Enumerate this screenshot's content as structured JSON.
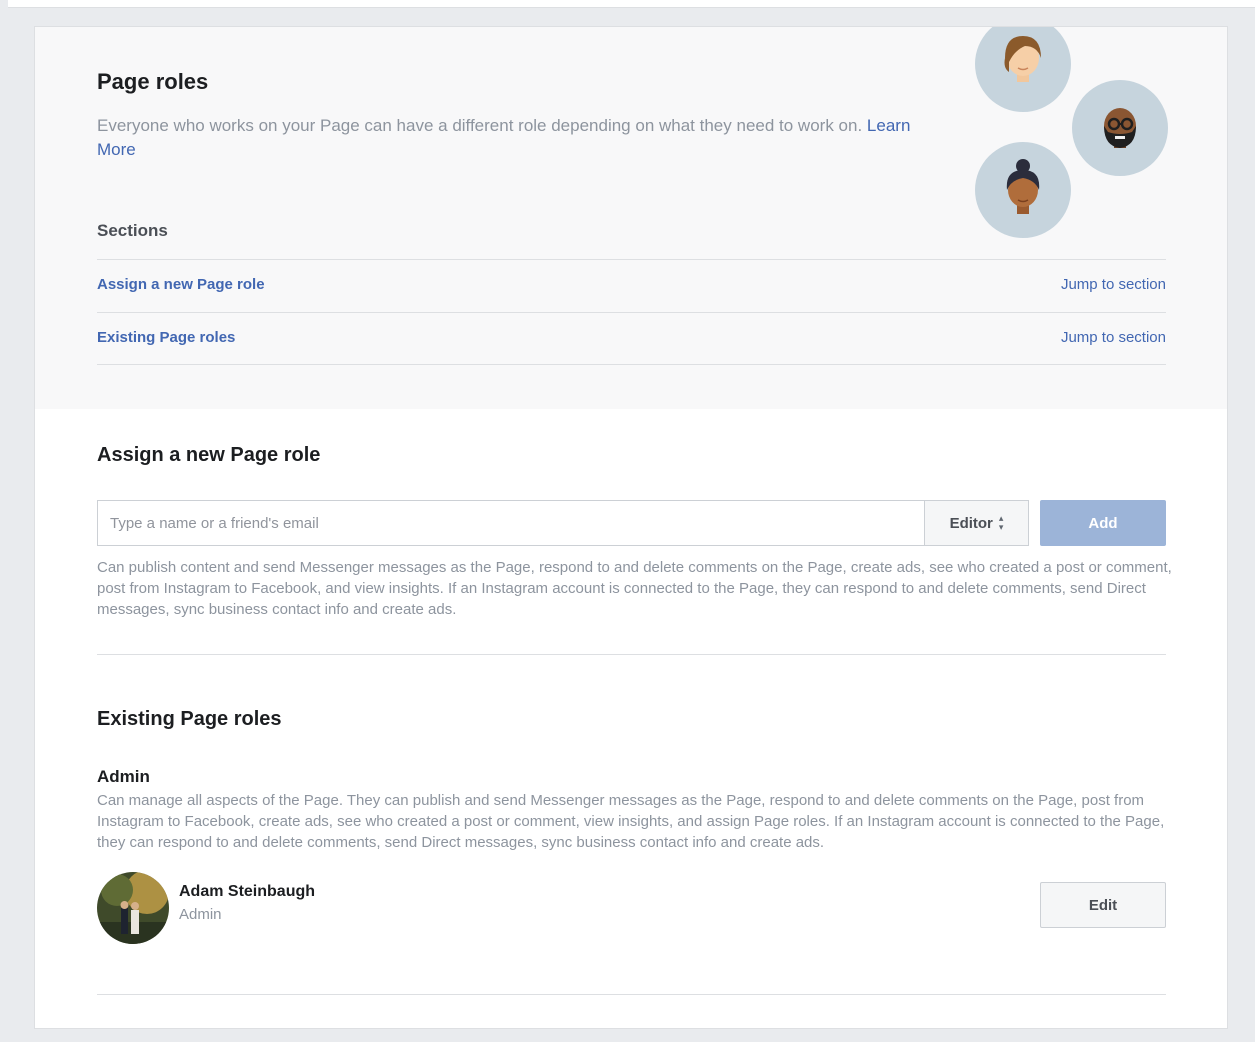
{
  "header": {
    "title": "Page roles",
    "description": "Everyone who works on your Page can have a different role depending on what they need to work on.",
    "learn_more": "Learn More"
  },
  "sections": {
    "label": "Sections",
    "items": [
      {
        "label": "Assign a new Page role",
        "jump": "Jump to section"
      },
      {
        "label": "Existing Page roles",
        "jump": "Jump to section"
      }
    ]
  },
  "assign": {
    "title": "Assign a new Page role",
    "placeholder": "Type a name or a friend's email",
    "role_selected": "Editor",
    "add_label": "Add",
    "role_description": "Can publish content and send Messenger messages as the Page, respond to and delete comments on the Page, create ads, see who created a post or comment, post from Instagram to Facebook, and view insights. If an Instagram account is connected to the Page, they can respond to and delete comments, send Direct messages, sync business contact info and create ads."
  },
  "existing": {
    "title": "Existing Page roles",
    "admin_title": "Admin",
    "admin_description": "Can manage all aspects of the Page. They can publish and send Messenger messages as the Page, respond to and delete comments on the Page, post from Instagram to Facebook, create ads, see who created a post or comment, view insights, and assign Page roles. If an Instagram account is connected to the Page, they can respond to and delete comments, send Direct messages, sync business contact info and create ads.",
    "users": [
      {
        "name": "Adam Steinbaugh",
        "role": "Admin",
        "edit_label": "Edit"
      }
    ]
  },
  "colors": {
    "link": "#4267b2",
    "muted_text": "#8d949e",
    "add_button": "#9cb4d8",
    "avatar_bg": "#c6d4dd"
  },
  "icons": [
    "person-woman-brown-hair-icon",
    "person-man-beard-glasses-icon",
    "person-woman-bun-icon",
    "user-photo"
  ]
}
